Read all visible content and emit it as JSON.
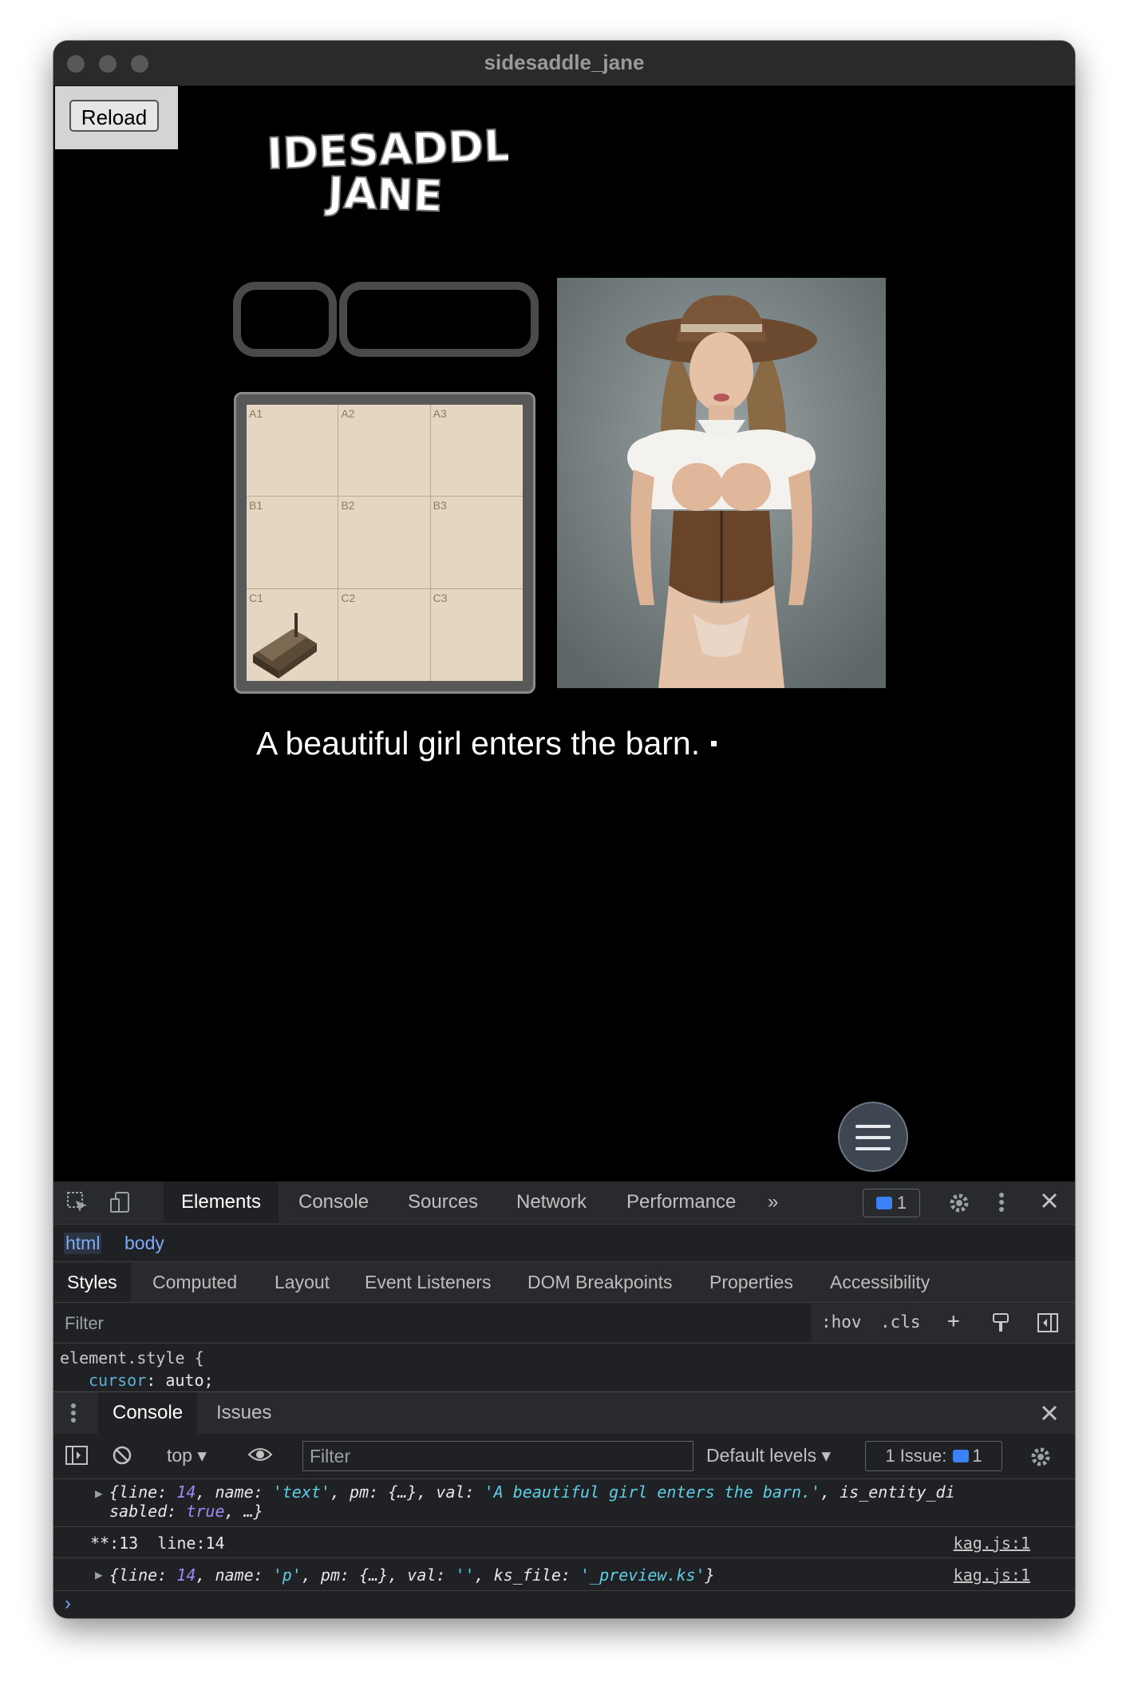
{
  "window": {
    "title": "sidesaddle_jane"
  },
  "game": {
    "reload_label": "Reload",
    "logo_lines": [
      "SIDESADDLE",
      "JANE"
    ],
    "map_cells": [
      "A1",
      "A2",
      "A3",
      "B1",
      "B2",
      "B3",
      "C1",
      "C2",
      "C3"
    ],
    "message": "A beautiful girl enters the barn."
  },
  "devtools": {
    "tabs": [
      "Elements",
      "Console",
      "Sources",
      "Network",
      "Performance"
    ],
    "more_tabs": "»",
    "issues_badge": "1",
    "breadcrumbs": [
      "html",
      "body"
    ],
    "subtabs": [
      "Styles",
      "Computed",
      "Layout",
      "Event Listeners",
      "DOM Breakpoints",
      "Properties",
      "Accessibility"
    ],
    "filter_placeholder": "Filter",
    "hov": ":hov",
    "cls": ".cls",
    "style_selector": "element.style {",
    "style_prop": "cursor",
    "style_value": "auto;",
    "drawer_tabs": [
      "Console",
      "Issues"
    ],
    "console": {
      "context": "top",
      "filter_placeholder": "Filter",
      "levels": "Default levels",
      "issue_label": "1 Issue:",
      "issue_count": "1",
      "logs": [
        {
          "l1_part_a": "{line: ",
          "l1_num": "14",
          "l1_part_b": ", name: ",
          "l1_name": "'text'",
          "l1_part_c": ", pm: {…}, val: ",
          "l1_val": "'A beautiful girl enters the barn.'",
          "l1_part_d": ", is_entity_di",
          "l2_part_a": "sabled: ",
          "l2_kw": "true",
          "l2_part_b": ", …}"
        },
        {
          "text": "**:13  line:14",
          "source": "kag.js:1"
        },
        {
          "part_a": "{line: ",
          "num": "14",
          "part_b": ", name: ",
          "name": "'p'",
          "part_c": ", pm: {…}, val: ",
          "val": "''",
          "part_d": ", ks_file: ",
          "file": "'_preview.ks'",
          "part_e": "}",
          "source": "kag.js:1"
        }
      ],
      "prompt": "›"
    }
  },
  "colors": {
    "game_bg": "#000000",
    "devtools_bg": "#202124",
    "accent_blue": "#3b82f6",
    "menu_button": "#3d4651"
  }
}
